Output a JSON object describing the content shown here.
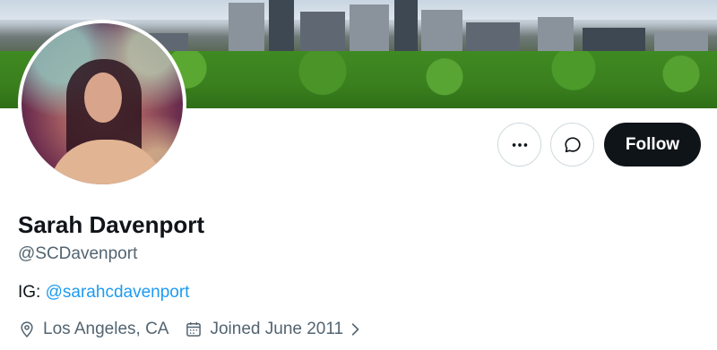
{
  "profile": {
    "name": "Sarah Davenport",
    "handle": "@SCDavenport",
    "bio_prefix": "IG: ",
    "bio_link": "@sarahcdavenport",
    "location": "Los Angeles, CA",
    "joined": "Joined June 2011"
  },
  "actions": {
    "more_icon": "more-horizontal-icon",
    "message_icon": "message-icon",
    "follow_label": "Follow"
  },
  "colors": {
    "link": "#1d9bf0",
    "follow_bg": "#0f1419",
    "secondary_text": "#536471"
  }
}
